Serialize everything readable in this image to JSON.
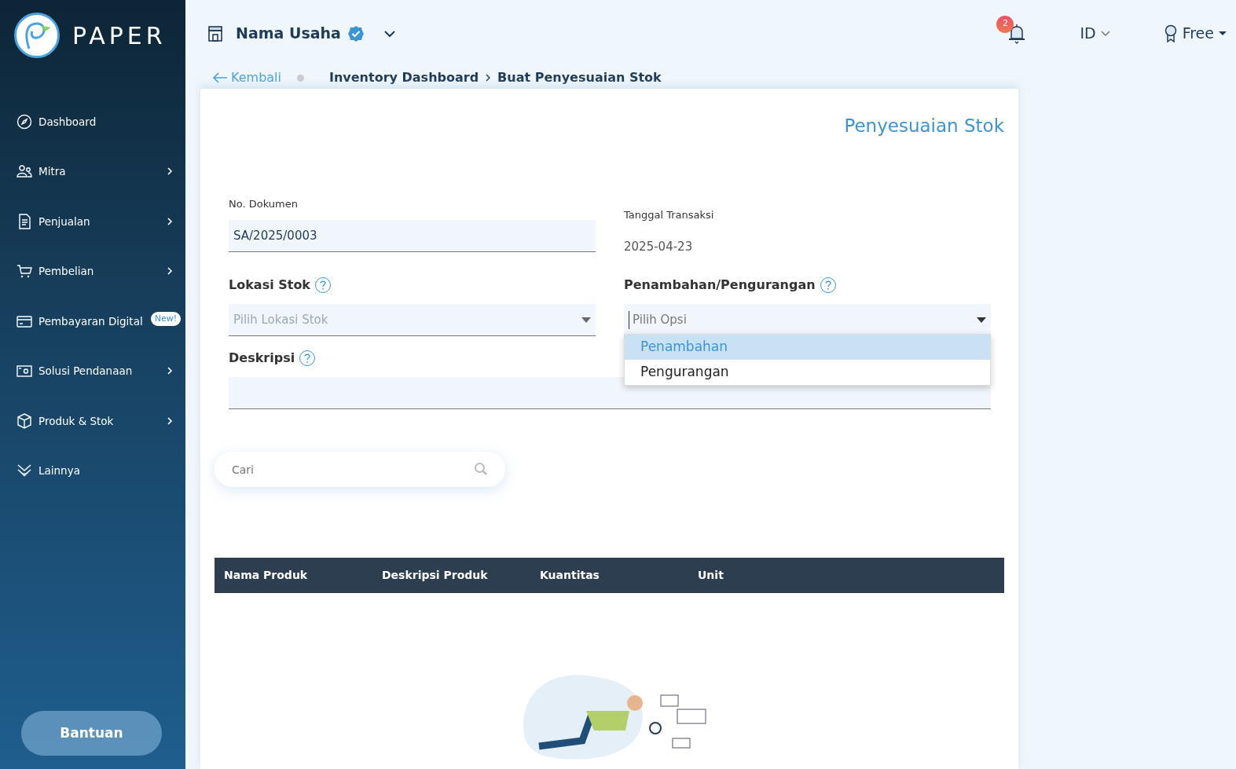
{
  "sidebar": {
    "logo_text": "PAPER",
    "items": [
      {
        "label": "Dashboard",
        "has_submenu": false
      },
      {
        "label": "Mitra",
        "has_submenu": true
      },
      {
        "label": "Penjualan",
        "has_submenu": true
      },
      {
        "label": "Pembelian",
        "has_submenu": true
      },
      {
        "label": "Pembayaran Digital",
        "has_submenu": false,
        "badge": "New!"
      },
      {
        "label": "Solusi Pendanaan",
        "has_submenu": true
      },
      {
        "label": "Produk & Stok",
        "has_submenu": true
      },
      {
        "label": "Lainnya",
        "has_submenu": false
      }
    ],
    "help_button": "Bantuan"
  },
  "header": {
    "business_name": "Nama Usaha",
    "verified": true,
    "notification_count": "2",
    "language": "ID",
    "plan": "Free"
  },
  "breadcrumb": {
    "back": "Kembali",
    "items": [
      "Inventory Dashboard",
      "Buat Penyesuaian Stok"
    ]
  },
  "form": {
    "title": "Penyesuaian Stok",
    "document_number": {
      "label": "No. Dokumen",
      "value": "SA/2025/0003"
    },
    "transaction_date": {
      "label": "Tanggal Transaksi",
      "value": "2025-04-23"
    },
    "stock_location": {
      "label": "Lokasi Stok",
      "placeholder": "Pilih Lokasi Stok"
    },
    "adjustment_type": {
      "label": "Penambahan/Pengurangan",
      "placeholder": "Pilih Opsi",
      "expanded": true,
      "options": [
        {
          "label": "Penambahan",
          "selected": true
        },
        {
          "label": "Pengurangan",
          "selected": false
        }
      ]
    },
    "description": {
      "label": "Deskripsi"
    }
  },
  "search": {
    "placeholder": "Cari"
  },
  "table": {
    "columns": [
      "Nama Produk",
      "Deskripsi Produk",
      "Kuantitas",
      "Unit"
    ]
  }
}
